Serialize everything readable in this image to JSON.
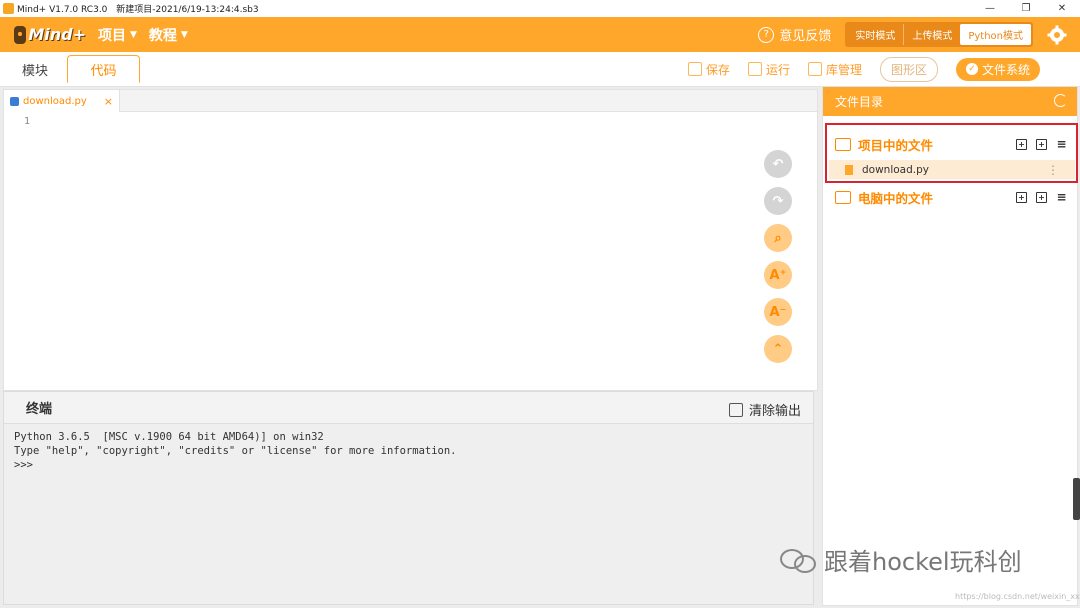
{
  "window": {
    "app_name": "Mind+ V1.7.0 RC3.0",
    "project_name": "新建项目-2021/6/19-13:24:4.sb3",
    "minimize": "—",
    "restore": "❐",
    "close": "✕"
  },
  "menubar": {
    "logo": "Mind+",
    "project_menu": "项目",
    "tutorial_menu": "教程",
    "feedback": "意见反馈",
    "modes": [
      "实时模式",
      "上传模式",
      "Python模式"
    ],
    "active_mode": "Python模式"
  },
  "toolbar": {
    "blocks_tab": "模块",
    "code_tab": "代码",
    "save": "保存",
    "run": "运行",
    "library": "库管理",
    "graphics": "图形区",
    "file_system": "文件系统"
  },
  "editor": {
    "tab_filename": "download.py",
    "tab_close": "×",
    "line_number": "1"
  },
  "terminal": {
    "title": "终端",
    "clear_label": "清除输出",
    "output": "Python 3.6.5  [MSC v.1900 64 bit AMD64)] on win32\nType \"help\", \"copyright\", \"credits\" or \"license\" for more information.\n>>>"
  },
  "file_panel": {
    "title": "文件目录",
    "project_files_label": "项目中的文件",
    "computer_files_label": "电脑中的文件",
    "file_name": "download.py"
  },
  "watermark": {
    "text": "跟着hockel玩科创",
    "url": "https://blog.csdn.net/weixin_xxxxx"
  },
  "colors": {
    "accent": "#ffa72b",
    "accent_dark": "#ff8a00",
    "highlight_border": "#d9232e"
  }
}
